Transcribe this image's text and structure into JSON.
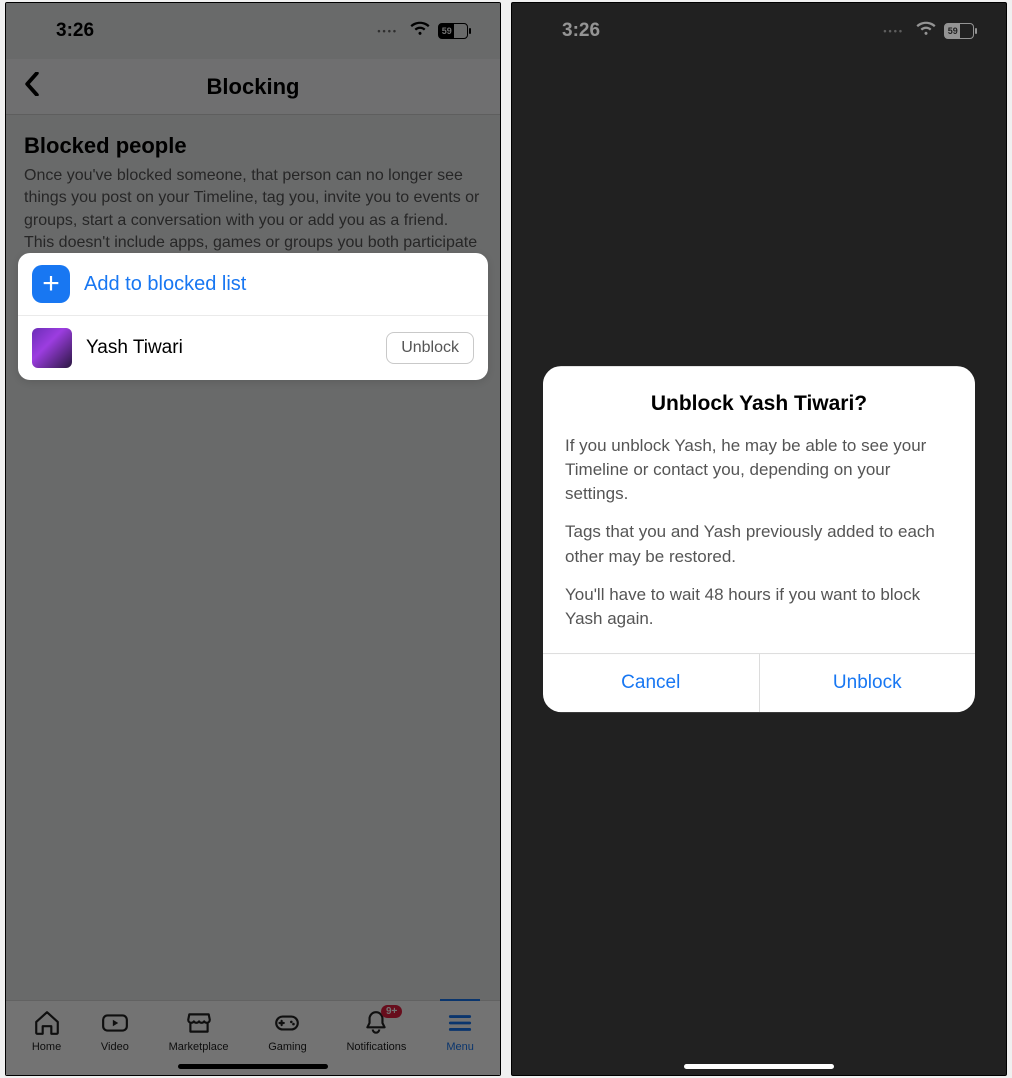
{
  "status": {
    "time": "3:26",
    "battery_text": "59"
  },
  "left": {
    "header": {
      "title": "Blocking"
    },
    "section": {
      "title": "Blocked people",
      "desc": "Once you've blocked someone, that person can no longer see things you post on your Timeline, tag you, invite you to events or groups, start a conversation with you or add you as a friend. This doesn't include apps, games or groups you both participate in."
    },
    "add_label": "Add to blocked list",
    "blocked": [
      {
        "name": "Yash Tiwari",
        "action": "Unblock"
      }
    ],
    "tabs": {
      "home": "Home",
      "video": "Video",
      "marketplace": "Marketplace",
      "gaming": "Gaming",
      "notifications": "Notifications",
      "menu": "Menu",
      "badge": "9+"
    }
  },
  "right": {
    "dialog": {
      "title": "Unblock Yash Tiwari?",
      "p1": "If you unblock Yash, he may be able to see your Timeline or contact you, depending on your settings.",
      "p2": "Tags that you and Yash previously added to each other may be restored.",
      "p3": "You'll have to wait 48 hours if you want to block Yash again.",
      "cancel": "Cancel",
      "unblock": "Unblock"
    }
  }
}
